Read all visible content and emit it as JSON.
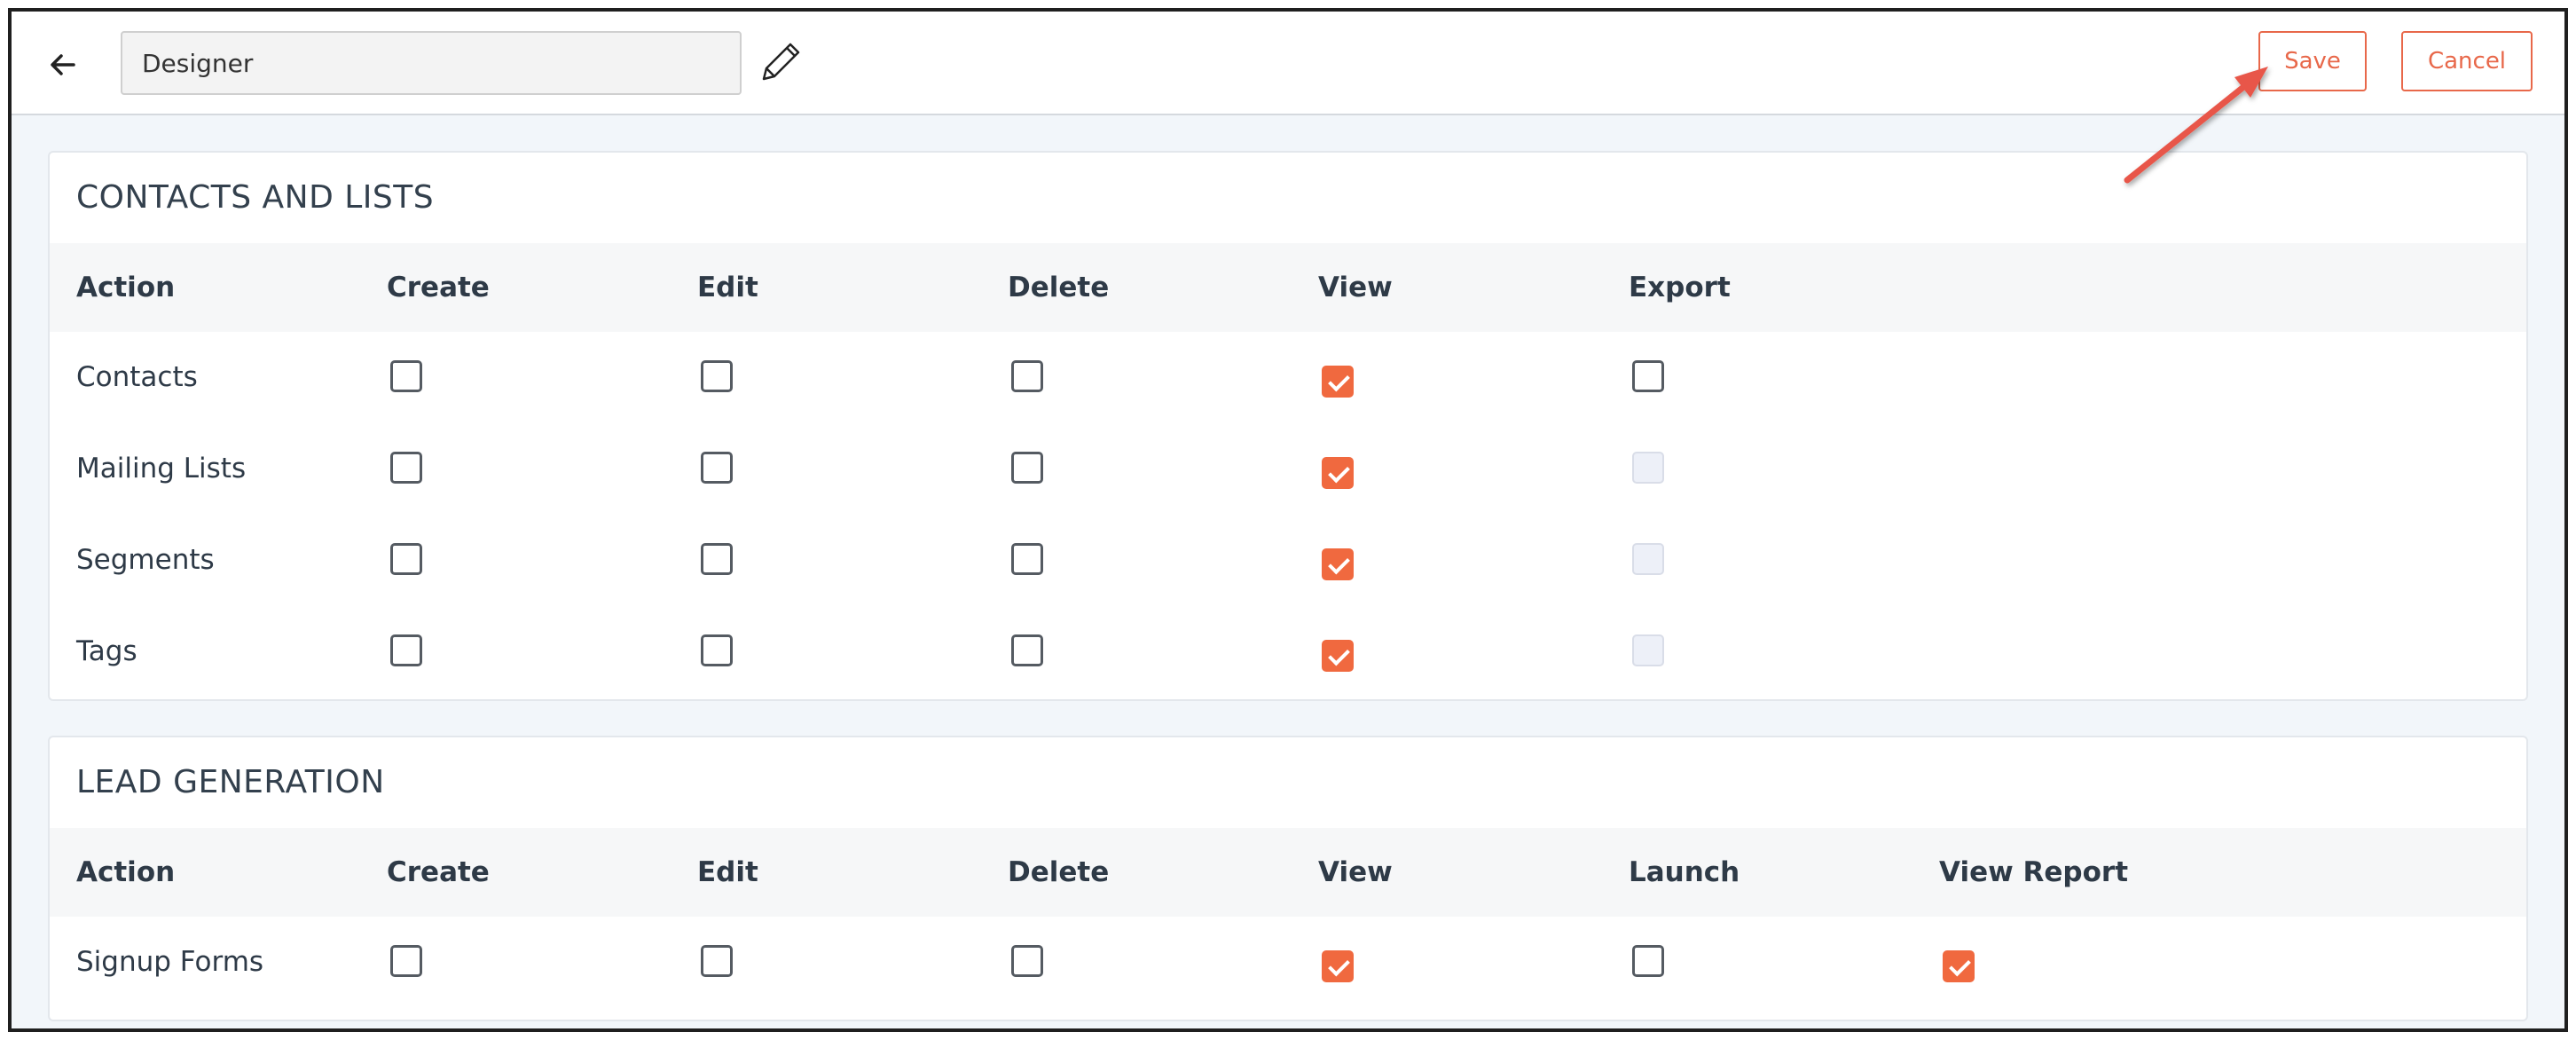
{
  "header": {
    "role_name": "Designer",
    "save_label": "Save",
    "cancel_label": "Cancel"
  },
  "sections": [
    {
      "title": "CONTACTS AND LISTS",
      "columns": [
        "Action",
        "Create",
        "Edit",
        "Delete",
        "View",
        "Export"
      ],
      "rows": [
        {
          "label": "Contacts",
          "cells": [
            "unchecked",
            "unchecked",
            "unchecked",
            "checked",
            "unchecked"
          ]
        },
        {
          "label": "Mailing Lists",
          "cells": [
            "unchecked",
            "unchecked",
            "unchecked",
            "checked",
            "disabled"
          ]
        },
        {
          "label": "Segments",
          "cells": [
            "unchecked",
            "unchecked",
            "unchecked",
            "checked",
            "disabled"
          ]
        },
        {
          "label": "Tags",
          "cells": [
            "unchecked",
            "unchecked",
            "unchecked",
            "checked",
            "disabled"
          ]
        }
      ]
    },
    {
      "title": "LEAD GENERATION",
      "columns": [
        "Action",
        "Create",
        "Edit",
        "Delete",
        "View",
        "Launch",
        "View Report"
      ],
      "rows": [
        {
          "label": "Signup Forms",
          "cells": [
            "unchecked",
            "unchecked",
            "unchecked",
            "checked",
            "unchecked",
            "checked"
          ]
        }
      ]
    }
  ],
  "icons": {
    "back": "arrow-left-icon",
    "edit": "pencil-icon"
  },
  "colors": {
    "accent": "#e8684a",
    "checkbox_checked": "#f0693f",
    "annotation_arrow": "#e8574a"
  }
}
